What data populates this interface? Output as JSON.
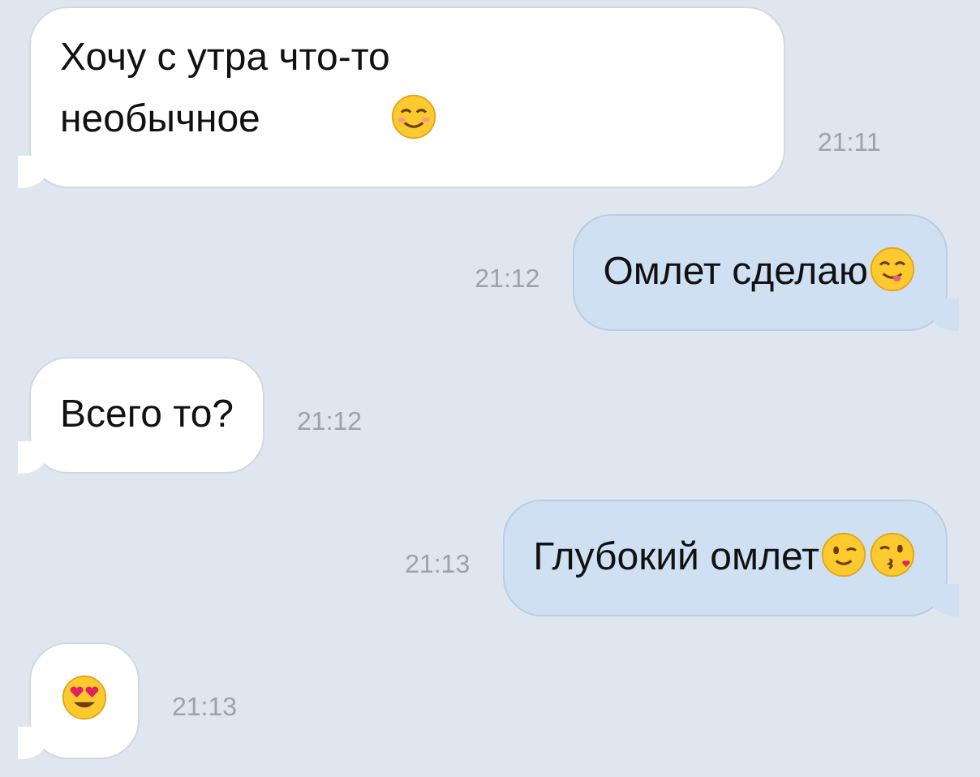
{
  "messages": [
    {
      "kind": "incoming",
      "text": "Хочу с утра что-то\nнеобычное",
      "emojis": [
        {
          "kind": "blush"
        }
      ],
      "time": "21:11"
    },
    {
      "kind": "outgoing",
      "text": "Омлет сделаю",
      "emojis": [
        {
          "kind": "yum"
        }
      ],
      "time": "21:12"
    },
    {
      "kind": "incoming",
      "text": "Всего то?",
      "time": "21:12"
    },
    {
      "kind": "outgoing",
      "text": "Глубокий омлет",
      "emojis": [
        {
          "kind": "wink"
        },
        {
          "kind": "kiss"
        }
      ],
      "time": "21:13"
    },
    {
      "kind": "incoming",
      "emojis": [
        {
          "kind": "heart_eyes"
        }
      ],
      "time": "21:13"
    }
  ]
}
